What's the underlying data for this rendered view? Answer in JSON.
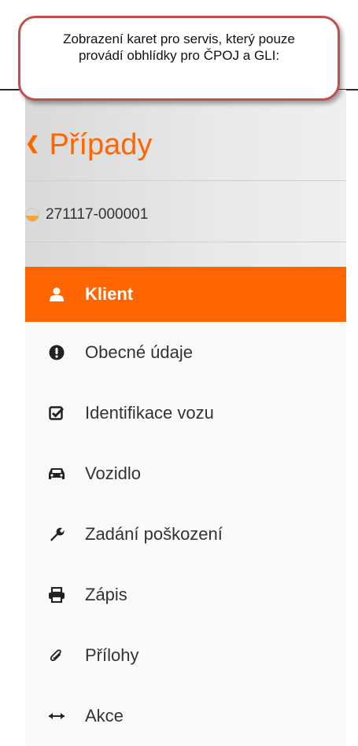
{
  "callout": {
    "text": "Zobrazení karet pro servis, který pouze provádí obhlídky pro ČPOJ a GLI:"
  },
  "sidebar": {
    "back_label": "Případy",
    "case_id": "271117-000001",
    "accent_color": "#ff6600",
    "items": [
      {
        "label": "Klient",
        "icon": "user-icon",
        "active": true
      },
      {
        "label": "Obecné údaje",
        "icon": "exclamation-circle-icon",
        "active": false
      },
      {
        "label": "Identifikace vozu",
        "icon": "check-square-icon",
        "active": false
      },
      {
        "label": "Vozidlo",
        "icon": "car-icon",
        "active": false
      },
      {
        "label": "Zadání poškození",
        "icon": "wrench-icon",
        "active": false
      },
      {
        "label": "Zápis",
        "icon": "printer-icon",
        "active": false
      },
      {
        "label": "Přílohy",
        "icon": "paperclip-icon",
        "active": false
      },
      {
        "label": "Akce",
        "icon": "arrows-horizontal-icon",
        "active": false
      }
    ]
  }
}
